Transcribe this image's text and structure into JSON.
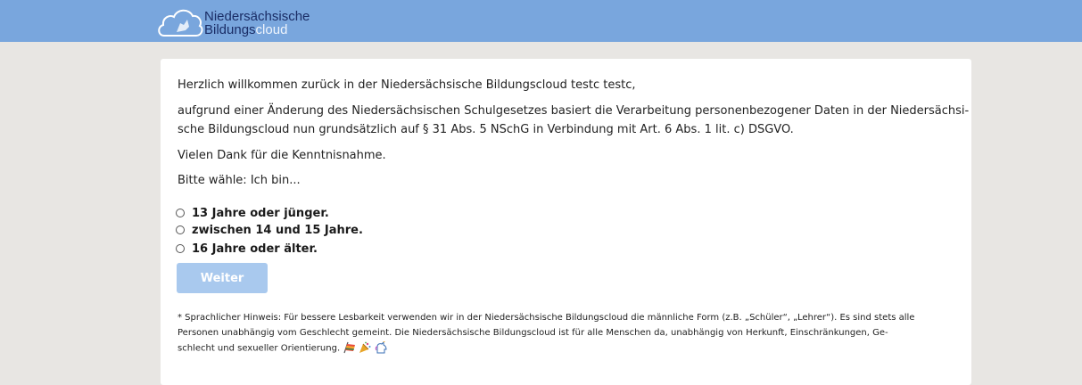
{
  "header": {
    "logo_line1": "Niedersächsische",
    "logo_line2a": "Bildungs",
    "logo_line2b": "cloud"
  },
  "main": {
    "greeting": "Herzlich willkommen zurück in der Niedersächsische Bildungscloud testc testc,",
    "para1_line1": "aufgrund einer Änderung des Niedersächsischen Schulgesetzes basiert die Verarbeitung personenbezogener Daten in der Niedersächsi-",
    "para1_line2": "sche Bildungscloud nun grundsätzlich auf § 31 Abs. 5 NSchG in Verbindung mit Art. 6 Abs. 1 lit. c) DSGVO.",
    "thanks": "Vielen Dank für die Kenntnisnahme.",
    "prompt": "Bitte wähle: Ich bin...",
    "options": [
      "13 Jahre oder jünger.",
      "zwischen 14 und 15 Jahre.",
      "16 Jahre oder älter."
    ],
    "next_button": "Weiter",
    "note_line1": "* Sprachlicher Hinweis: Für bessere Lesbarkeit verwenden wir in der Niedersächsische Bildungscloud die männliche Form (z.B. „Schüler“, „Lehrer“). Es sind stets alle",
    "note_line2": "Personen unabhängig vom Geschlecht gemeint. Die Niedersächsische Bildungscloud ist für alle Menschen da, unabhängig von Herkunft, Einschränkungen, Ge-",
    "note_line3": "schlecht und sexueller Orientierung."
  },
  "colors": {
    "header_bg": "#79a6dd",
    "button_bg": "#a9c9ee",
    "page_bg": "#e8e6e3"
  },
  "icons": [
    "cloud-unicorn-logo-icon",
    "rainbow-flag-icon",
    "party-popper-icon",
    "unicorn-icon"
  ]
}
